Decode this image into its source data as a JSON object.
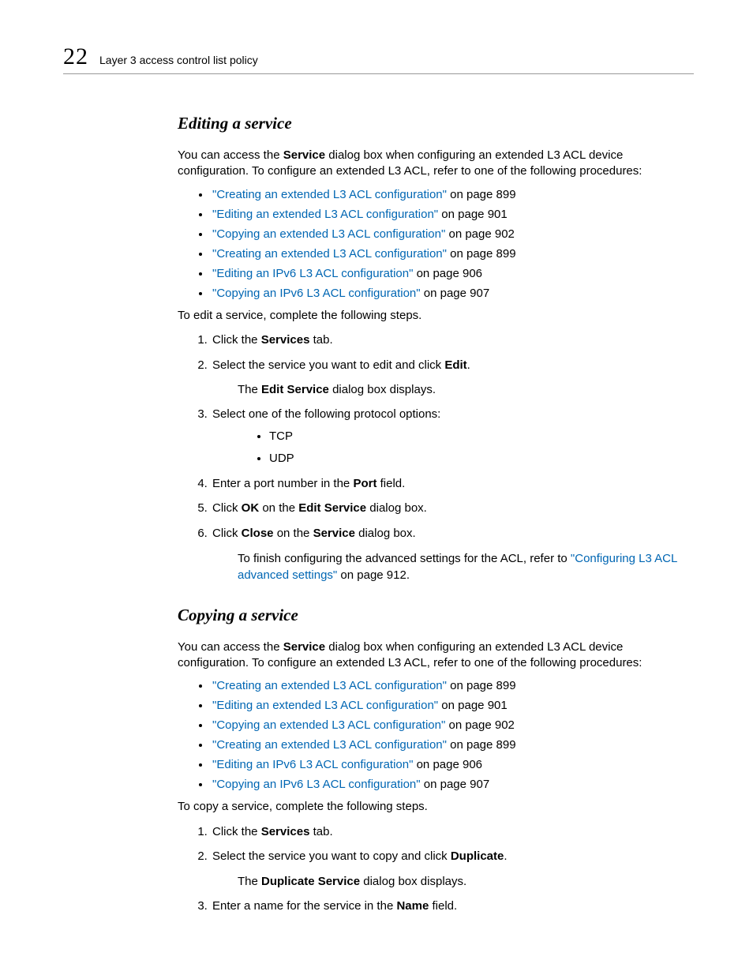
{
  "header": {
    "chapter_number": "22",
    "chapter_title": "Layer 3 access control list policy"
  },
  "s1": {
    "heading": "Editing a service",
    "intro_a": "You can access the ",
    "intro_b": "Service",
    "intro_c": " dialog box when configuring an extended L3 ACL device configuration. To configure an extended L3 ACL, refer to one of the following procedures:",
    "xrefs": [
      {
        "link": "\"Creating an extended L3 ACL configuration\"",
        "tail": " on page 899"
      },
      {
        "link": "\"Editing an extended L3 ACL configuration\"",
        "tail": " on page 901"
      },
      {
        "link": "\"Copying an extended L3 ACL configuration\"",
        "tail": " on page 902"
      },
      {
        "link": "\"Creating an extended L3 ACL configuration\"",
        "tail": " on page 899"
      },
      {
        "link": "\"Editing an IPv6 L3 ACL configuration\"",
        "tail": " on page 906"
      },
      {
        "link": "\"Copying an IPv6 L3 ACL configuration\"",
        "tail": " on page 907"
      }
    ],
    "lead": "To edit a service, complete the following steps.",
    "step1_a": "Click the ",
    "step1_b": "Services",
    "step1_c": " tab.",
    "step2_a": "Select the service you want to edit and click ",
    "step2_b": "Edit",
    "step2_c": ".",
    "step2_sub_a": "The ",
    "step2_sub_b": "Edit Service",
    "step2_sub_c": " dialog box displays.",
    "step3": "Select one of the following protocol options:",
    "step3_opts": [
      "TCP",
      "UDP"
    ],
    "step4_a": "Enter a port number in the ",
    "step4_b": "Port",
    "step4_c": " field.",
    "step5_a": "Click ",
    "step5_b": "OK",
    "step5_c": " on the ",
    "step5_d": "Edit Service",
    "step5_e": " dialog box.",
    "step6_a": "Click ",
    "step6_b": "Close",
    "step6_c": " on the ",
    "step6_d": "Service",
    "step6_e": " dialog box.",
    "step6_sub_a": "To finish configuring the advanced settings for the ACL, refer to ",
    "step6_sub_link": "\"Configuring L3 ACL advanced settings\"",
    "step6_sub_b": " on page 912."
  },
  "s2": {
    "heading": "Copying a service",
    "intro_a": "You can access the ",
    "intro_b": "Service",
    "intro_c": " dialog box when configuring an extended L3 ACL device configuration. To configure an extended L3 ACL, refer to one of the following procedures:",
    "xrefs": [
      {
        "link": "\"Creating an extended L3 ACL configuration\"",
        "tail": " on page 899"
      },
      {
        "link": "\"Editing an extended L3 ACL configuration\"",
        "tail": " on page 901"
      },
      {
        "link": "\"Copying an extended L3 ACL configuration\"",
        "tail": " on page 902"
      },
      {
        "link": "\"Creating an extended L3 ACL configuration\"",
        "tail": " on page 899"
      },
      {
        "link": "\"Editing an IPv6 L3 ACL configuration\"",
        "tail": " on page 906"
      },
      {
        "link": "\"Copying an IPv6 L3 ACL configuration\"",
        "tail": " on page 907"
      }
    ],
    "lead": "To copy a service, complete the following steps.",
    "step1_a": "Click the ",
    "step1_b": "Services",
    "step1_c": " tab.",
    "step2_a": "Select the service you want to copy and click ",
    "step2_b": "Duplicate",
    "step2_c": ".",
    "step2_sub_a": "The ",
    "step2_sub_b": "Duplicate Service",
    "step2_sub_c": " dialog box displays.",
    "step3_a": "Enter a name for the service in the ",
    "step3_b": "Name",
    "step3_c": " field."
  }
}
